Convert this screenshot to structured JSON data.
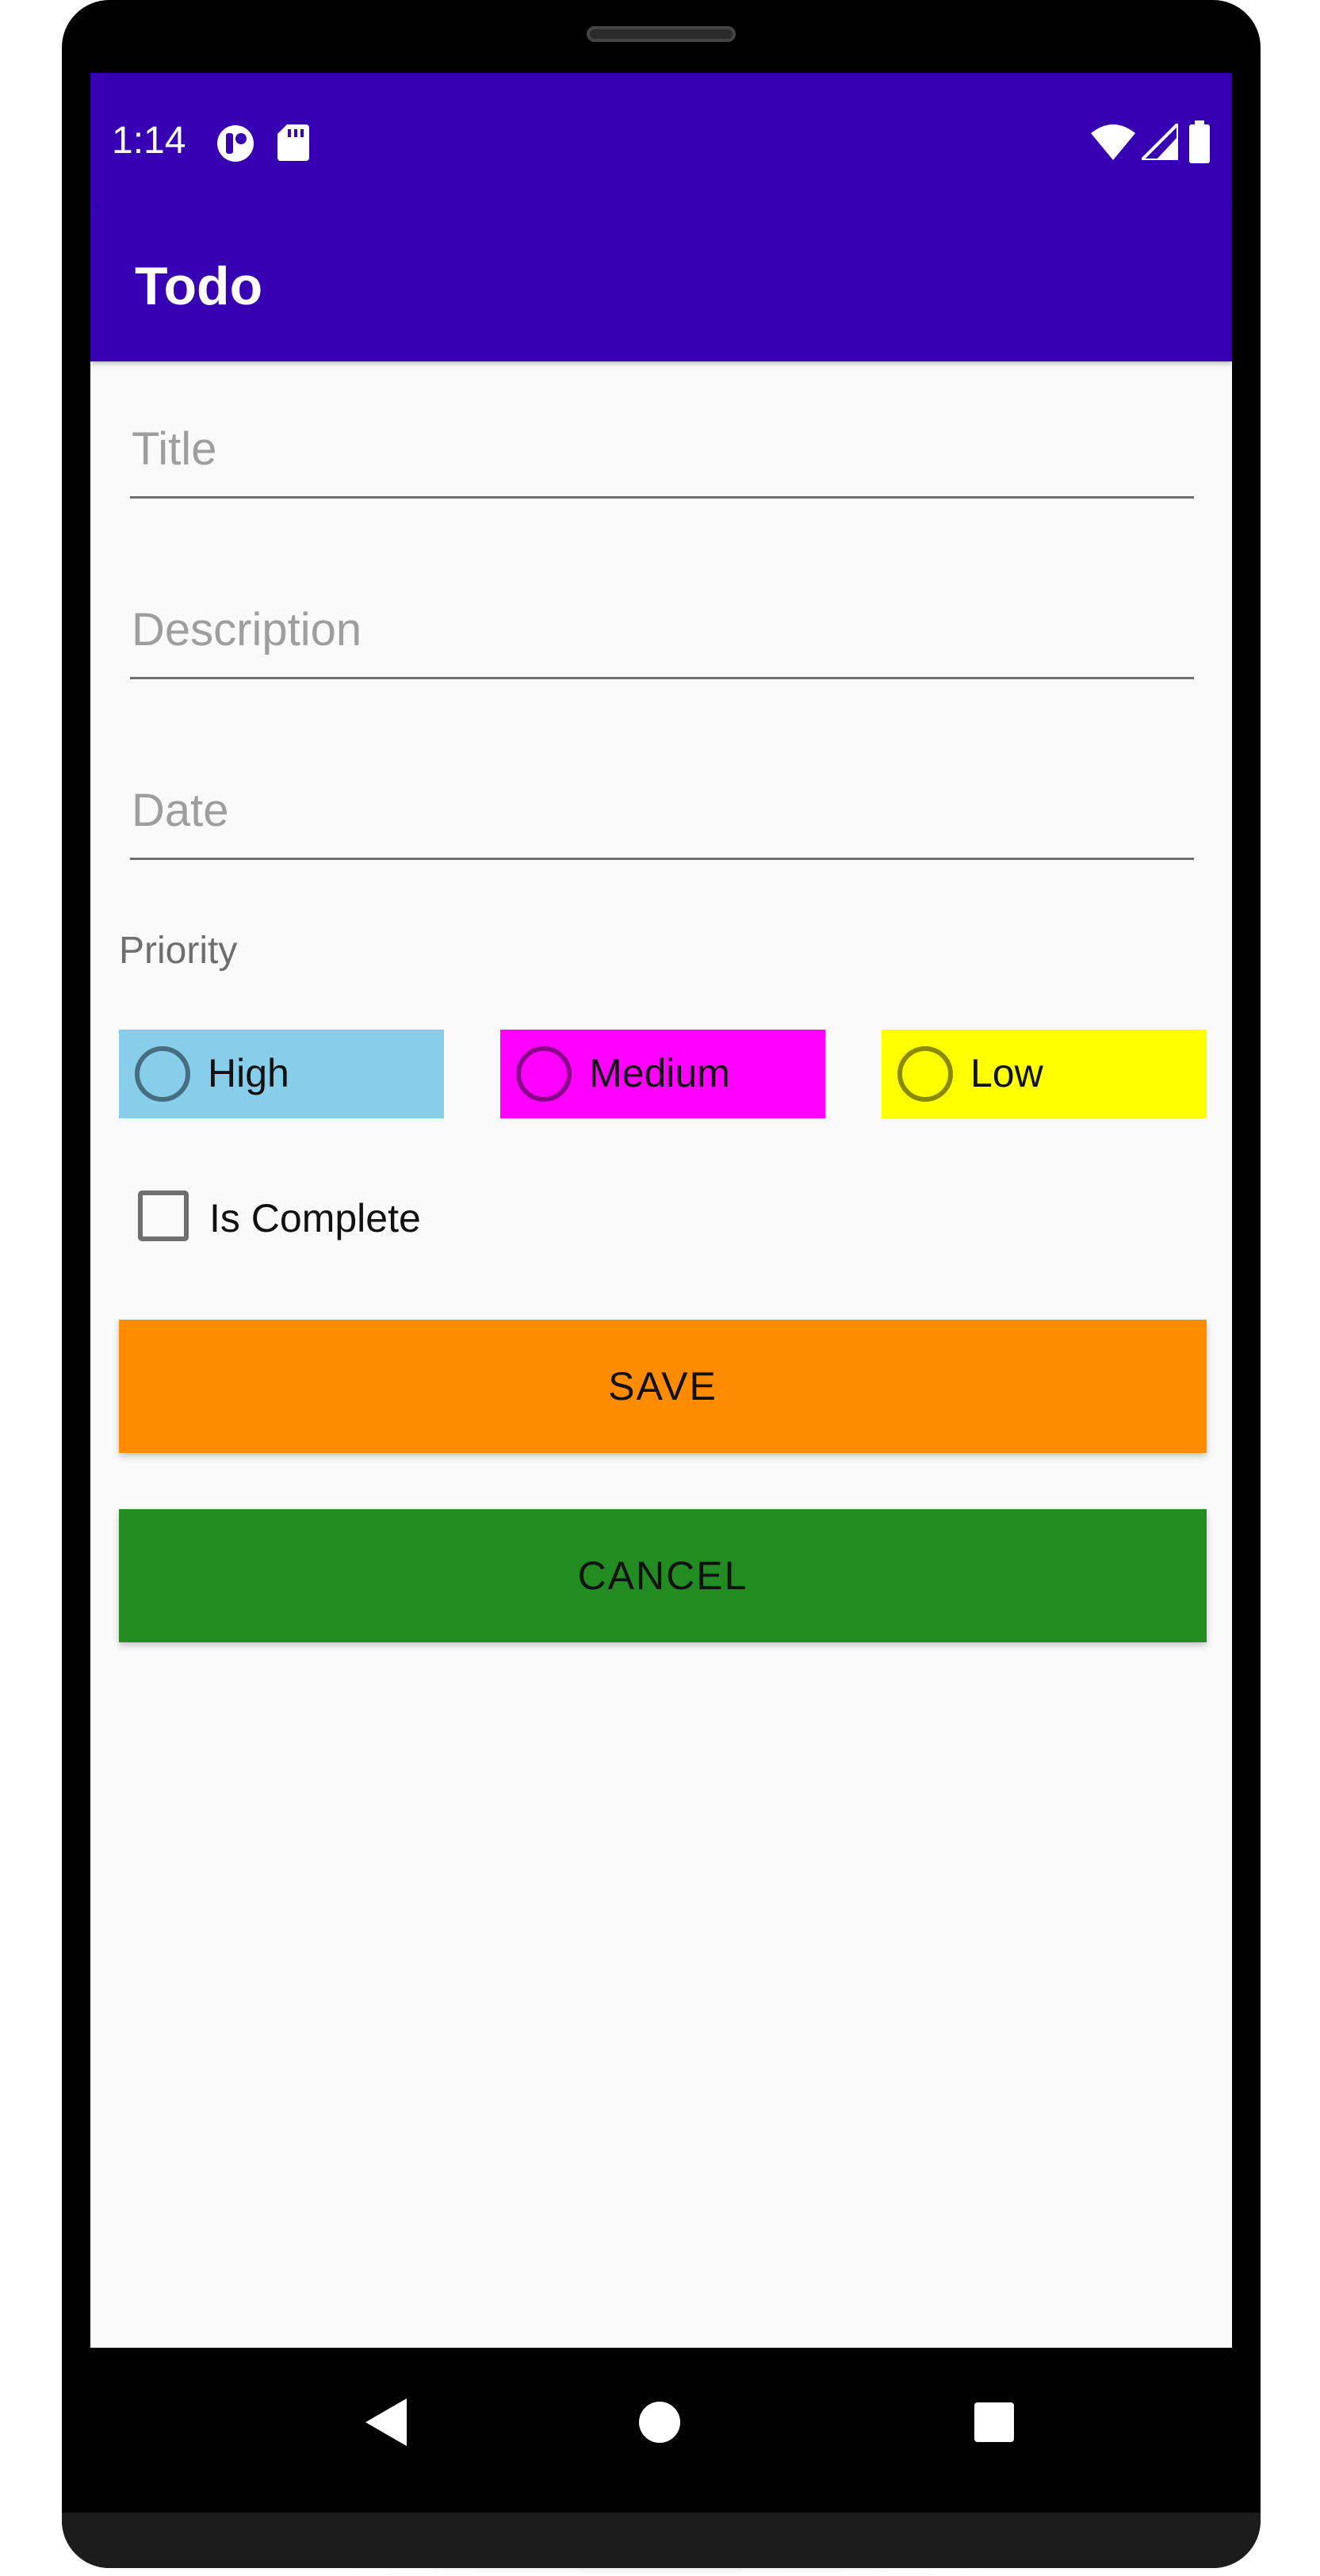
{
  "status_bar": {
    "time": "1:14",
    "left_icons": [
      "app-notification-icon",
      "sd-card-icon"
    ],
    "right_icons": [
      "wifi-icon",
      "cell-signal-icon",
      "battery-icon"
    ],
    "color": "#3700b3"
  },
  "app_bar": {
    "title": "Todo",
    "color": "#3700b3"
  },
  "form": {
    "title_placeholder": "Title",
    "title_value": "",
    "description_placeholder": "Description",
    "description_value": "",
    "date_placeholder": "Date",
    "date_value": "",
    "priority_label": "Priority",
    "priority_options": [
      {
        "label": "High",
        "color": "#87ceeb",
        "selected": false
      },
      {
        "label": "Medium",
        "color": "#ff00ff",
        "selected": false
      },
      {
        "label": "Low",
        "color": "#ffff00",
        "selected": false
      }
    ],
    "is_complete_label": "Is Complete",
    "is_complete_checked": false
  },
  "buttons": {
    "save_label": "SAVE",
    "save_color": "#ff8c00",
    "cancel_label": "CANCEL",
    "cancel_color": "#228b22"
  },
  "nav_bar": {
    "icons": [
      "back-icon",
      "home-icon",
      "recents-icon"
    ]
  }
}
